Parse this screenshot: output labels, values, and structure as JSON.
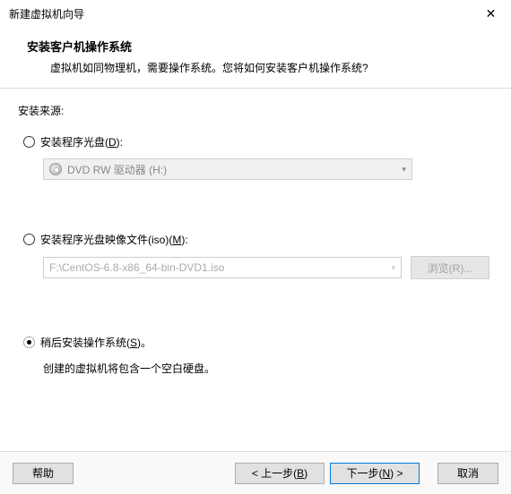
{
  "titlebar": {
    "title": "新建虚拟机向导"
  },
  "header": {
    "title": "安装客户机操作系统",
    "subtitle": "虚拟机如同物理机，需要操作系统。您将如何安装客户机操作系统?"
  },
  "body": {
    "source_label": "安装来源:",
    "opt_disc": {
      "label_pre": "安装程序光盘(",
      "accel": "D",
      "label_post": "):"
    },
    "disc_dropdown": {
      "text": "DVD RW 驱动器 (H:)"
    },
    "opt_iso": {
      "label_pre": "安装程序光盘映像文件(iso)(",
      "accel": "M",
      "label_post": "):"
    },
    "iso_path": "F:\\CentOS-6.8-x86_64-bin-DVD1.iso",
    "browse": {
      "pre": "浏览(",
      "accel": "R",
      "post": ")..."
    },
    "opt_later": {
      "label_pre": "稍后安装操作系统(",
      "accel": "S",
      "label_post": ")。"
    },
    "later_hint": "创建的虚拟机将包含一个空白硬盘。"
  },
  "footer": {
    "help": "帮助",
    "back": {
      "pre": "< 上一步(",
      "accel": "B",
      "post": ")"
    },
    "next": {
      "pre": "下一步(",
      "accel": "N",
      "post": ") >"
    },
    "cancel": "取消"
  }
}
